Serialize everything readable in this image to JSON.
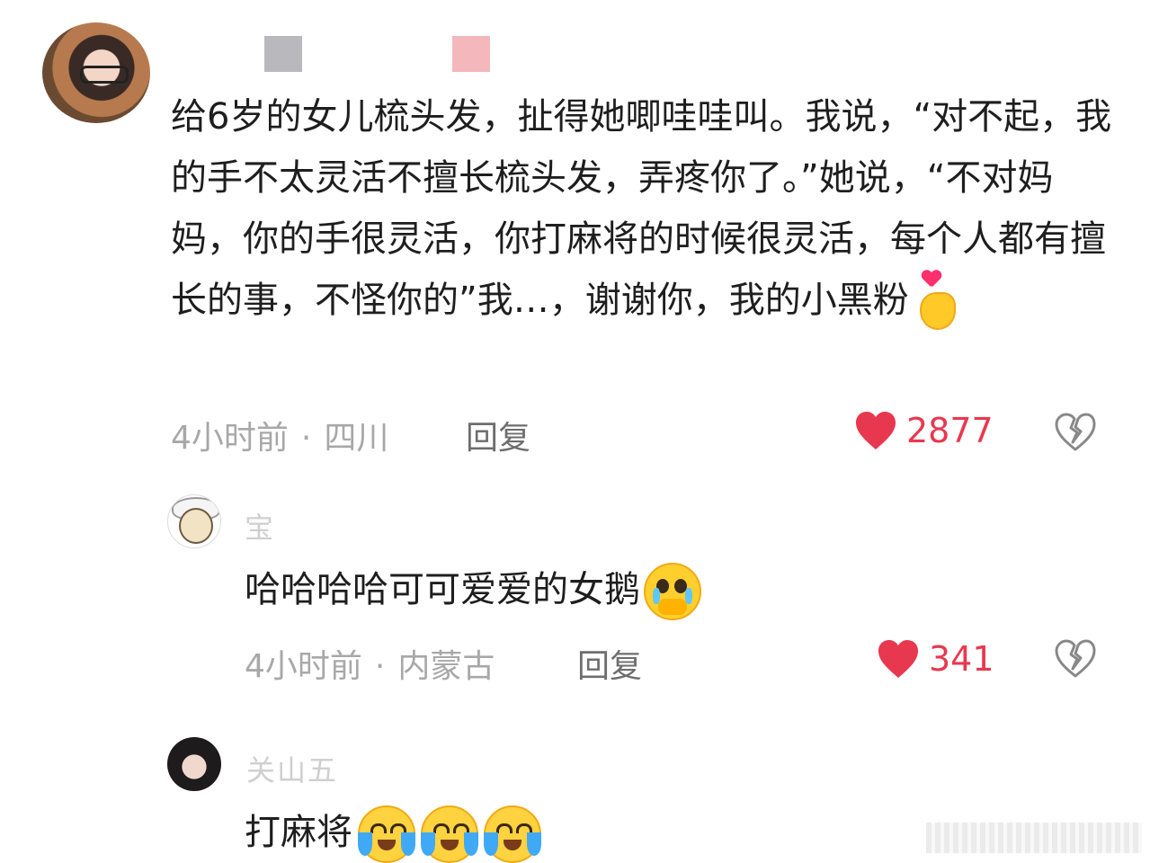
{
  "comments": [
    {
      "text": "给6岁的女儿梳头发，扯得她唧哇哇叫。我说，“对不起，我的手不太灵活不擅长梳头发，弄疼你了。”她说，“不对妈妈，你的手很灵活，你打麻将的时候很灵活，每个人都有擅长的事，不怪你的”我…，谢谢你，我的小黑粉",
      "time": "4小时前",
      "location": "四川",
      "reply_label": "回复",
      "likes": "2877"
    },
    {
      "username": "宝",
      "text": "哈哈哈哈可可爱爱的女鹅",
      "time": "4小时前",
      "location": "内蒙古",
      "reply_label": "回复",
      "likes": "341"
    },
    {
      "username": "关山五",
      "text": "打麻将"
    }
  ],
  "meta_separator": "·",
  "icons": {
    "like": "heart-icon",
    "dislike": "broken-heart-icon",
    "emoji_1": "finger-heart-emoji",
    "emoji_2": "holding-back-tears-emoji",
    "emoji_3": "crying-face-emoji"
  },
  "colors": {
    "like": "#e8384f",
    "meta": "#a8a8a8",
    "text": "#1e1e1e"
  }
}
